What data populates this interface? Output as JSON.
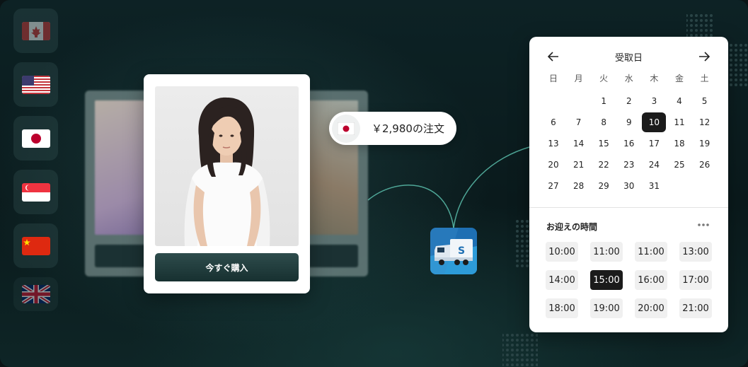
{
  "flags": [
    {
      "country": "Canada",
      "icon": "canada-flag-icon"
    },
    {
      "country": "United States",
      "icon": "us-flag-icon"
    },
    {
      "country": "Japan",
      "icon": "japan-flag-icon"
    },
    {
      "country": "Singapore",
      "icon": "singapore-flag-icon"
    },
    {
      "country": "China",
      "icon": "china-flag-icon"
    },
    {
      "country": "United Kingdom",
      "icon": "uk-flag-icon"
    }
  ],
  "product_card": {
    "buy_label": "今すぐ購入",
    "button_color": "#1f3a3a"
  },
  "order_pill": {
    "text": "￥2,980の注文",
    "flag_icon": "japan-flag-icon"
  },
  "shipping": {
    "icon": "delivery-truck-icon"
  },
  "calendar": {
    "title": "受取日",
    "prev_icon": "arrow-left-icon",
    "next_icon": "arrow-right-icon",
    "weekdays": [
      "日",
      "月",
      "火",
      "水",
      "木",
      "金",
      "土"
    ],
    "days": [
      "1",
      "2",
      "3",
      "4",
      "5",
      "6",
      "7",
      "8",
      "9",
      "10",
      "11",
      "12",
      "13",
      "14",
      "15",
      "16",
      "17",
      "18",
      "19",
      "20",
      "21",
      "22",
      "23",
      "24",
      "25",
      "26",
      "27",
      "28",
      "29",
      "30",
      "31"
    ],
    "first_weekday_index": 2,
    "selected_day": "10",
    "pickup_label": "お迎えの時間",
    "more_icon": "more-dots-icon",
    "times": [
      "10:00",
      "11:00",
      "11:00",
      "13:00",
      "14:00",
      "15:00",
      "16:00",
      "17:00",
      "18:00",
      "19:00",
      "20:00",
      "21:00"
    ],
    "selected_time_index": 5
  },
  "colors": {
    "background": "#0c1e20",
    "accent_line": "#5fc8b4",
    "selected": "#1b1b1b"
  }
}
